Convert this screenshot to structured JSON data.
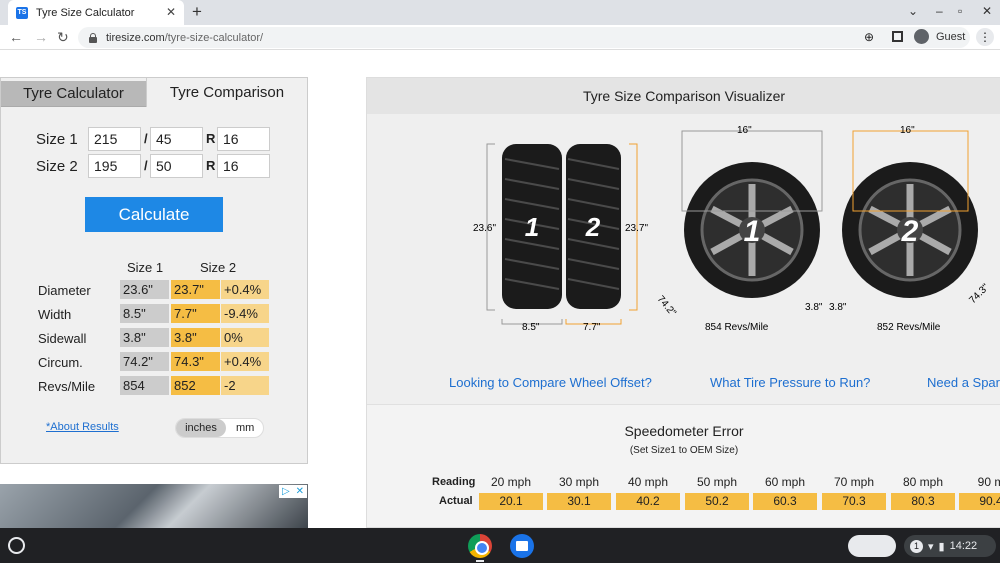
{
  "browser": {
    "tab_title": "Tyre Size Calculator",
    "favicon_text": "TS",
    "url_domain": "tiresize.com",
    "url_path": "/tyre-size-calculator/",
    "profile": "Guest"
  },
  "tabs": {
    "calc": "Tyre Calculator",
    "comp": "Tyre Comparison"
  },
  "inputs": {
    "size1_label": "Size 1",
    "size2_label": "Size 2",
    "s1_width": "215",
    "s1_aspect": "45",
    "s1_rim": "16",
    "s2_width": "195",
    "s2_aspect": "50",
    "s2_rim": "16",
    "sep": "/",
    "r": "R"
  },
  "calculate_label": "Calculate",
  "results": {
    "header_size1": "Size 1",
    "header_size2": "Size 2",
    "rows": [
      {
        "label": "Diameter",
        "s1": "23.6\"",
        "s2": "23.7\"",
        "diff": "+0.4%"
      },
      {
        "label": "Width",
        "s1": "8.5\"",
        "s2": "7.7\"",
        "diff": "-9.4%"
      },
      {
        "label": "Sidewall",
        "s1": "3.8\"",
        "s2": "3.8\"",
        "diff": "0%"
      },
      {
        "label": "Circum.",
        "s1": "74.2\"",
        "s2": "74.3\"",
        "diff": "+0.4%"
      },
      {
        "label": "Revs/Mile",
        "s1": "854",
        "s2": "852",
        "diff": "-2"
      }
    ]
  },
  "about_link": "*About Results",
  "units": {
    "inches": "inches",
    "mm": "mm"
  },
  "visualizer": {
    "title": "Tyre Size Comparison Visualizer",
    "tire1_label": "1",
    "tire2_label": "2",
    "d1": "23.6\"",
    "d2": "23.7\"",
    "w1": "8.5\"",
    "w2": "7.7\"",
    "rim1": "16\"",
    "rim2": "16\"",
    "circ1": "74.2\"",
    "circ2": "74.3\"",
    "side1": "3.8\"",
    "side2": "3.8\"",
    "revs1": "854 Revs/Mile",
    "revs2": "852 Revs/Mile"
  },
  "links": [
    "Looking to Compare Wheel Offset?",
    "What Tire Pressure to Run?",
    "Need a Spar"
  ],
  "speedo": {
    "title": "Speedometer Error",
    "subtitle": "(Set Size1 to OEM Size)",
    "reading_label": "Reading",
    "actual_label": "Actual",
    "reading": [
      "20 mph",
      "30 mph",
      "40 mph",
      "50 mph",
      "60 mph",
      "70 mph",
      "80 mph",
      "90 m"
    ],
    "actual": [
      "20.1",
      "30.1",
      "40.2",
      "50.2",
      "60.3",
      "70.3",
      "80.3",
      "90.4"
    ]
  },
  "taskbar": {
    "time": "14:22",
    "notif_count": "1"
  }
}
